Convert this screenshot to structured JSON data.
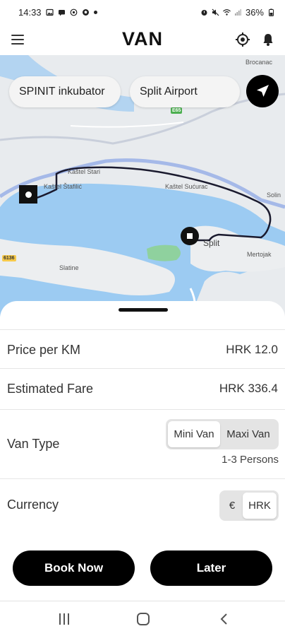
{
  "status_bar": {
    "time": "14:33",
    "battery": "36%"
  },
  "app": {
    "title": "VAN"
  },
  "icons": {
    "menu": "menu-icon",
    "locate": "crosshair-icon",
    "bell": "bell-icon",
    "navigate": "navigation-arrow-icon",
    "origin_marker": "origin-marker-icon",
    "destination_marker": "destination-marker-icon"
  },
  "map": {
    "from": "SPINIT inkubator",
    "to": "Split Airport",
    "labels": {
      "brocanac": "Brocanac",
      "kastel_stari": "Kaštel Stari",
      "kastel_stafilic": "Kaštel Štafilić",
      "kastel_sucurac": "Kaštel Sućurac",
      "solin": "Solin",
      "split": "Split",
      "mertojak": "Mertojak",
      "slatine": "Slatine",
      "road_e65": "E65",
      "road_6136": "6136"
    }
  },
  "sheet": {
    "price_label": "Price per KM",
    "price_value": "HRK 12.0",
    "fare_label": "Estimated Fare",
    "fare_value": "HRK 336.4",
    "van_type_label": "Van Type",
    "van_options": [
      "Mini Van",
      "Maxi Van"
    ],
    "van_selected": "Mini Van",
    "persons": "1-3 Persons",
    "currency_label": "Currency",
    "currency_options": [
      "€",
      "HRK"
    ],
    "currency_selected": "HRK",
    "book_now": "Book Now",
    "later": "Later"
  },
  "colors": {
    "primary": "#000000",
    "water": "#9ccbf2",
    "land": "#e8ebee",
    "park": "#8fd19e",
    "route": "#1a1a2e"
  }
}
